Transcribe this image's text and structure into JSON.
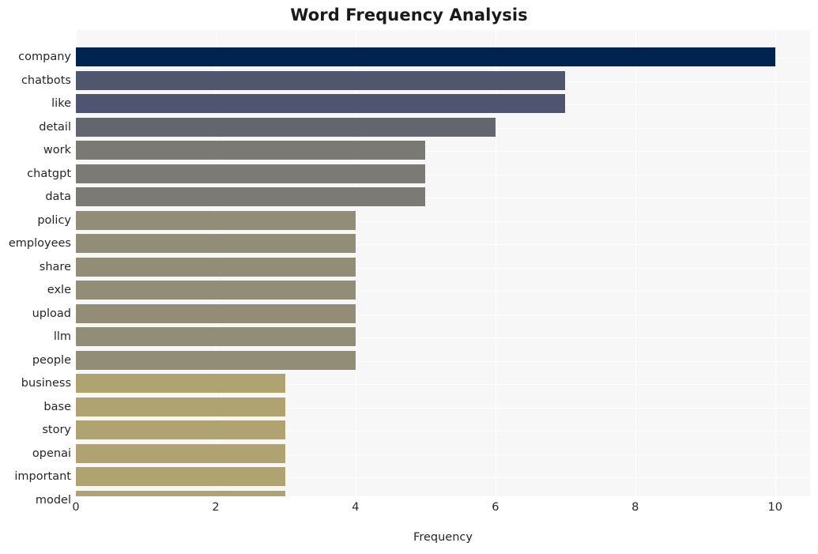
{
  "chart_data": {
    "type": "bar",
    "orientation": "horizontal",
    "title": "Word Frequency Analysis",
    "xlabel": "Frequency",
    "ylabel": "",
    "categories": [
      "company",
      "chatbots",
      "like",
      "detail",
      "work",
      "chatgpt",
      "data",
      "policy",
      "employees",
      "share",
      "exle",
      "upload",
      "llm",
      "people",
      "business",
      "base",
      "story",
      "openai",
      "important",
      "model"
    ],
    "values": [
      10,
      7,
      7,
      6,
      5,
      5,
      5,
      4,
      4,
      4,
      4,
      4,
      4,
      4,
      3,
      3,
      3,
      3,
      3,
      3
    ],
    "xlim": [
      0,
      10.5
    ],
    "xticks": [
      "0",
      "2",
      "4",
      "6",
      "8",
      "10"
    ],
    "xtick_values": [
      0,
      2,
      4,
      6,
      8,
      10
    ],
    "grid": true,
    "grid_color": "#ffffff",
    "legend": "none",
    "plot_background": "#f7f7f8",
    "figure_background": "#ffffff",
    "bar_colors": [
      "#00234f",
      "#4f566e",
      "#4f5570",
      "#64666e",
      "#7a7974",
      "#7b7a74",
      "#7c7a74",
      "#918d77",
      "#918d77",
      "#918d77",
      "#918d77",
      "#918d77",
      "#918d77",
      "#918d77",
      "#afa471",
      "#afa471",
      "#afa471",
      "#afa471",
      "#afa471",
      "#afa471"
    ]
  }
}
